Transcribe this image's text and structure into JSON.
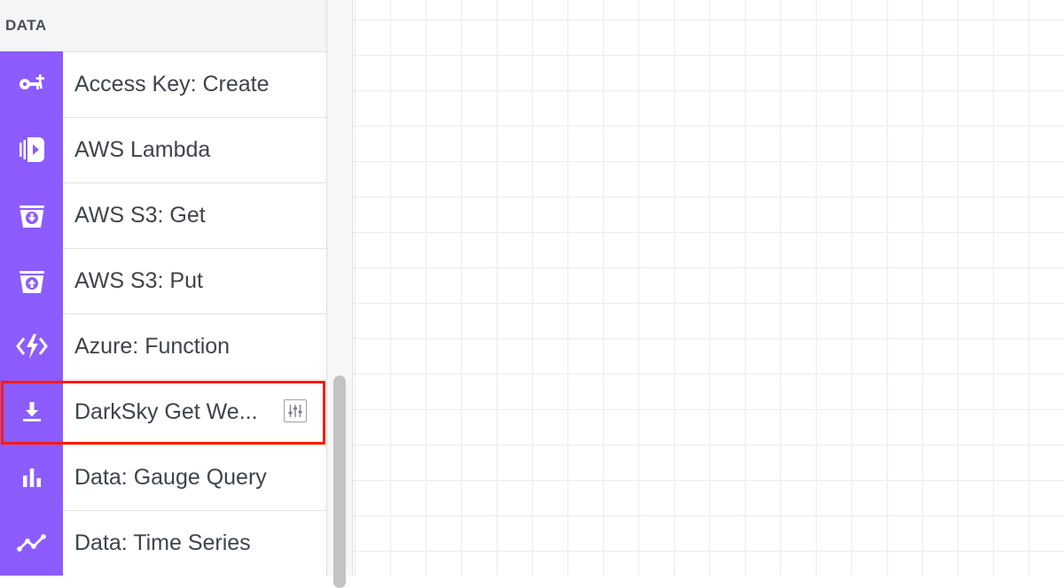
{
  "sidebar": {
    "section_title": "DATA",
    "items": [
      {
        "label": "Access Key: Create",
        "icon": "key-plus-icon"
      },
      {
        "label": "AWS Lambda",
        "icon": "aws-lambda-icon"
      },
      {
        "label": "AWS S3: Get",
        "icon": "bucket-download-icon"
      },
      {
        "label": "AWS S3: Put",
        "icon": "bucket-upload-icon"
      },
      {
        "label": "Azure: Function",
        "icon": "azure-function-icon"
      },
      {
        "label": "DarkSky Get We...",
        "icon": "download-icon",
        "highlighted": true
      },
      {
        "label": "Data: Gauge Query",
        "icon": "bar-chart-icon"
      },
      {
        "label": "Data: Time Series",
        "icon": "line-chart-icon"
      }
    ]
  },
  "colors": {
    "accent": "#8c5cff",
    "highlight": "#ff1a00",
    "text": "#3e444c"
  }
}
